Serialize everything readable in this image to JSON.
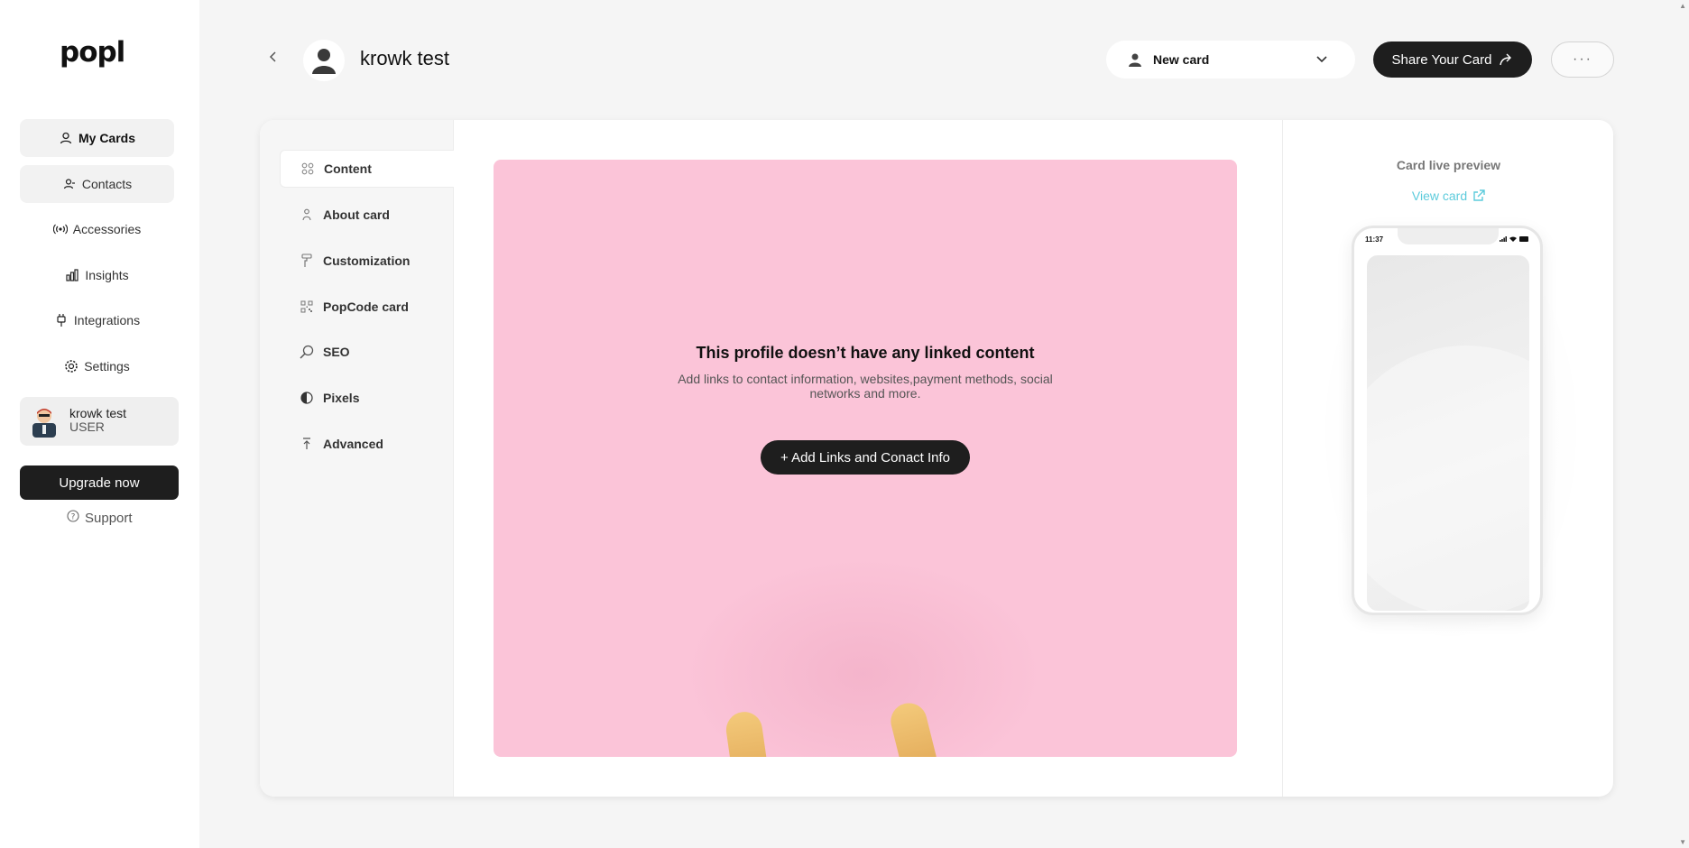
{
  "sidebar": {
    "logo": "popl",
    "nav": [
      {
        "label": "My Cards",
        "icon": "user-icon"
      },
      {
        "label": "Contacts",
        "icon": "contacts-icon"
      },
      {
        "label": "Accessories",
        "icon": "broadcast-icon"
      },
      {
        "label": "Insights",
        "icon": "bar-chart-icon"
      },
      {
        "label": "Integrations",
        "icon": "plug-icon"
      },
      {
        "label": "Settings",
        "icon": "gear-icon"
      }
    ],
    "user": {
      "name": "krowk test",
      "role": "USER"
    },
    "upgrade_label": "Upgrade now",
    "support_label": "Support"
  },
  "header": {
    "title": "krowk test",
    "card_select": "New card",
    "share_label": "Share Your Card",
    "more_label": "···"
  },
  "tabs": [
    {
      "label": "Content",
      "icon": "grid-icon"
    },
    {
      "label": "About card",
      "icon": "person-icon"
    },
    {
      "label": "Customization",
      "icon": "paint-roller-icon"
    },
    {
      "label": "PopCode card",
      "icon": "qr-icon"
    },
    {
      "label": "SEO",
      "icon": "search-icon"
    },
    {
      "label": "Pixels",
      "icon": "contrast-icon"
    },
    {
      "label": "Advanced",
      "icon": "arrow-up-bar-icon"
    }
  ],
  "content": {
    "empty_title": "This profile doesn’t have any linked content",
    "empty_subtitle": "Add links to contact information, websites,payment methods, social networks and more.",
    "add_button": "+ Add Links and Conact Info",
    "background_color": "#fbc4d8"
  },
  "preview": {
    "title": "Card live preview",
    "view_card": "View card",
    "phone_time": "11:37"
  }
}
